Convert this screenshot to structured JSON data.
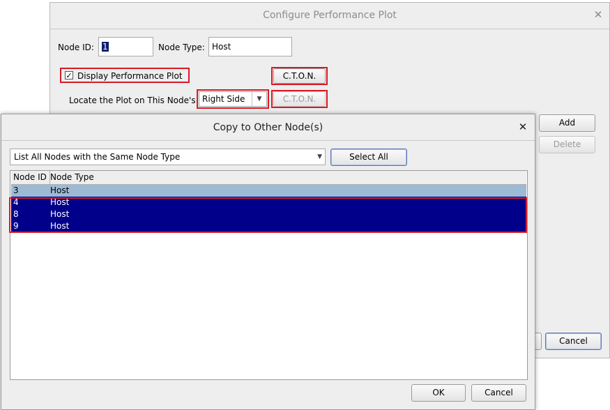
{
  "back_dialog": {
    "title": "Configure Performance Plot",
    "node_id_label": "Node ID:",
    "node_id_value": "1",
    "node_type_label": "Node Type:",
    "node_type_value": "Host",
    "display_checkbox_label": "Display Performance Plot",
    "ctonn_label": "C.T.O.N.",
    "locate_label": "Locate the Plot on This Node's",
    "locate_value": "Right Side",
    "add_label": "Add",
    "delete_label": "Delete",
    "cancel_label": "Cancel"
  },
  "front_dialog": {
    "title": "Copy to Other Node(s)",
    "filter_value": "List All Nodes with the Same Node Type",
    "select_all_label": "Select All",
    "columns": [
      "Node ID",
      "Node Type"
    ],
    "rows": [
      {
        "id": "3",
        "type": "Host"
      },
      {
        "id": "4",
        "type": "Host"
      },
      {
        "id": "8",
        "type": "Host"
      },
      {
        "id": "9",
        "type": "Host"
      }
    ],
    "ok_label": "OK",
    "cancel_label": "Cancel"
  }
}
